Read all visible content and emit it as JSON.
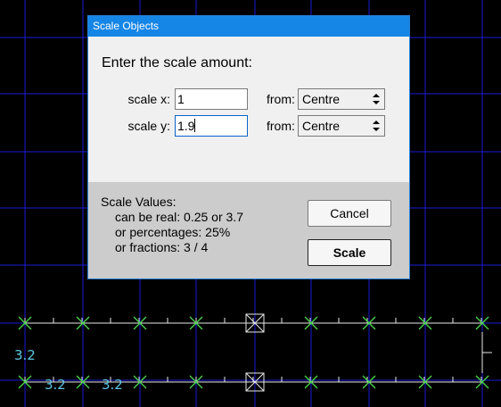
{
  "dialog": {
    "title": "Scale Objects",
    "prompt": "Enter the scale amount:",
    "scale_x": {
      "label": "scale x:",
      "value": "1",
      "from_label": "from:",
      "from_value": "Centre"
    },
    "scale_y": {
      "label": "scale y:",
      "value": "1.9",
      "from_label": "from:",
      "from_value": "Centre"
    },
    "help": {
      "heading": "Scale Values:",
      "lines": [
        "can be real: 0.25 or 3.7",
        "or percentages: 25%",
        "or fractions: 3 / 4"
      ]
    },
    "cancel_label": "Cancel",
    "scale_label": "Scale"
  },
  "canvas": {
    "labels": [
      "3.2",
      "3.2",
      "3.2"
    ],
    "colors": {
      "grid": "#1a1ad6",
      "line": "#e8e8e8",
      "marker": "#4cd44c",
      "label": "#5fc6e6"
    }
  }
}
